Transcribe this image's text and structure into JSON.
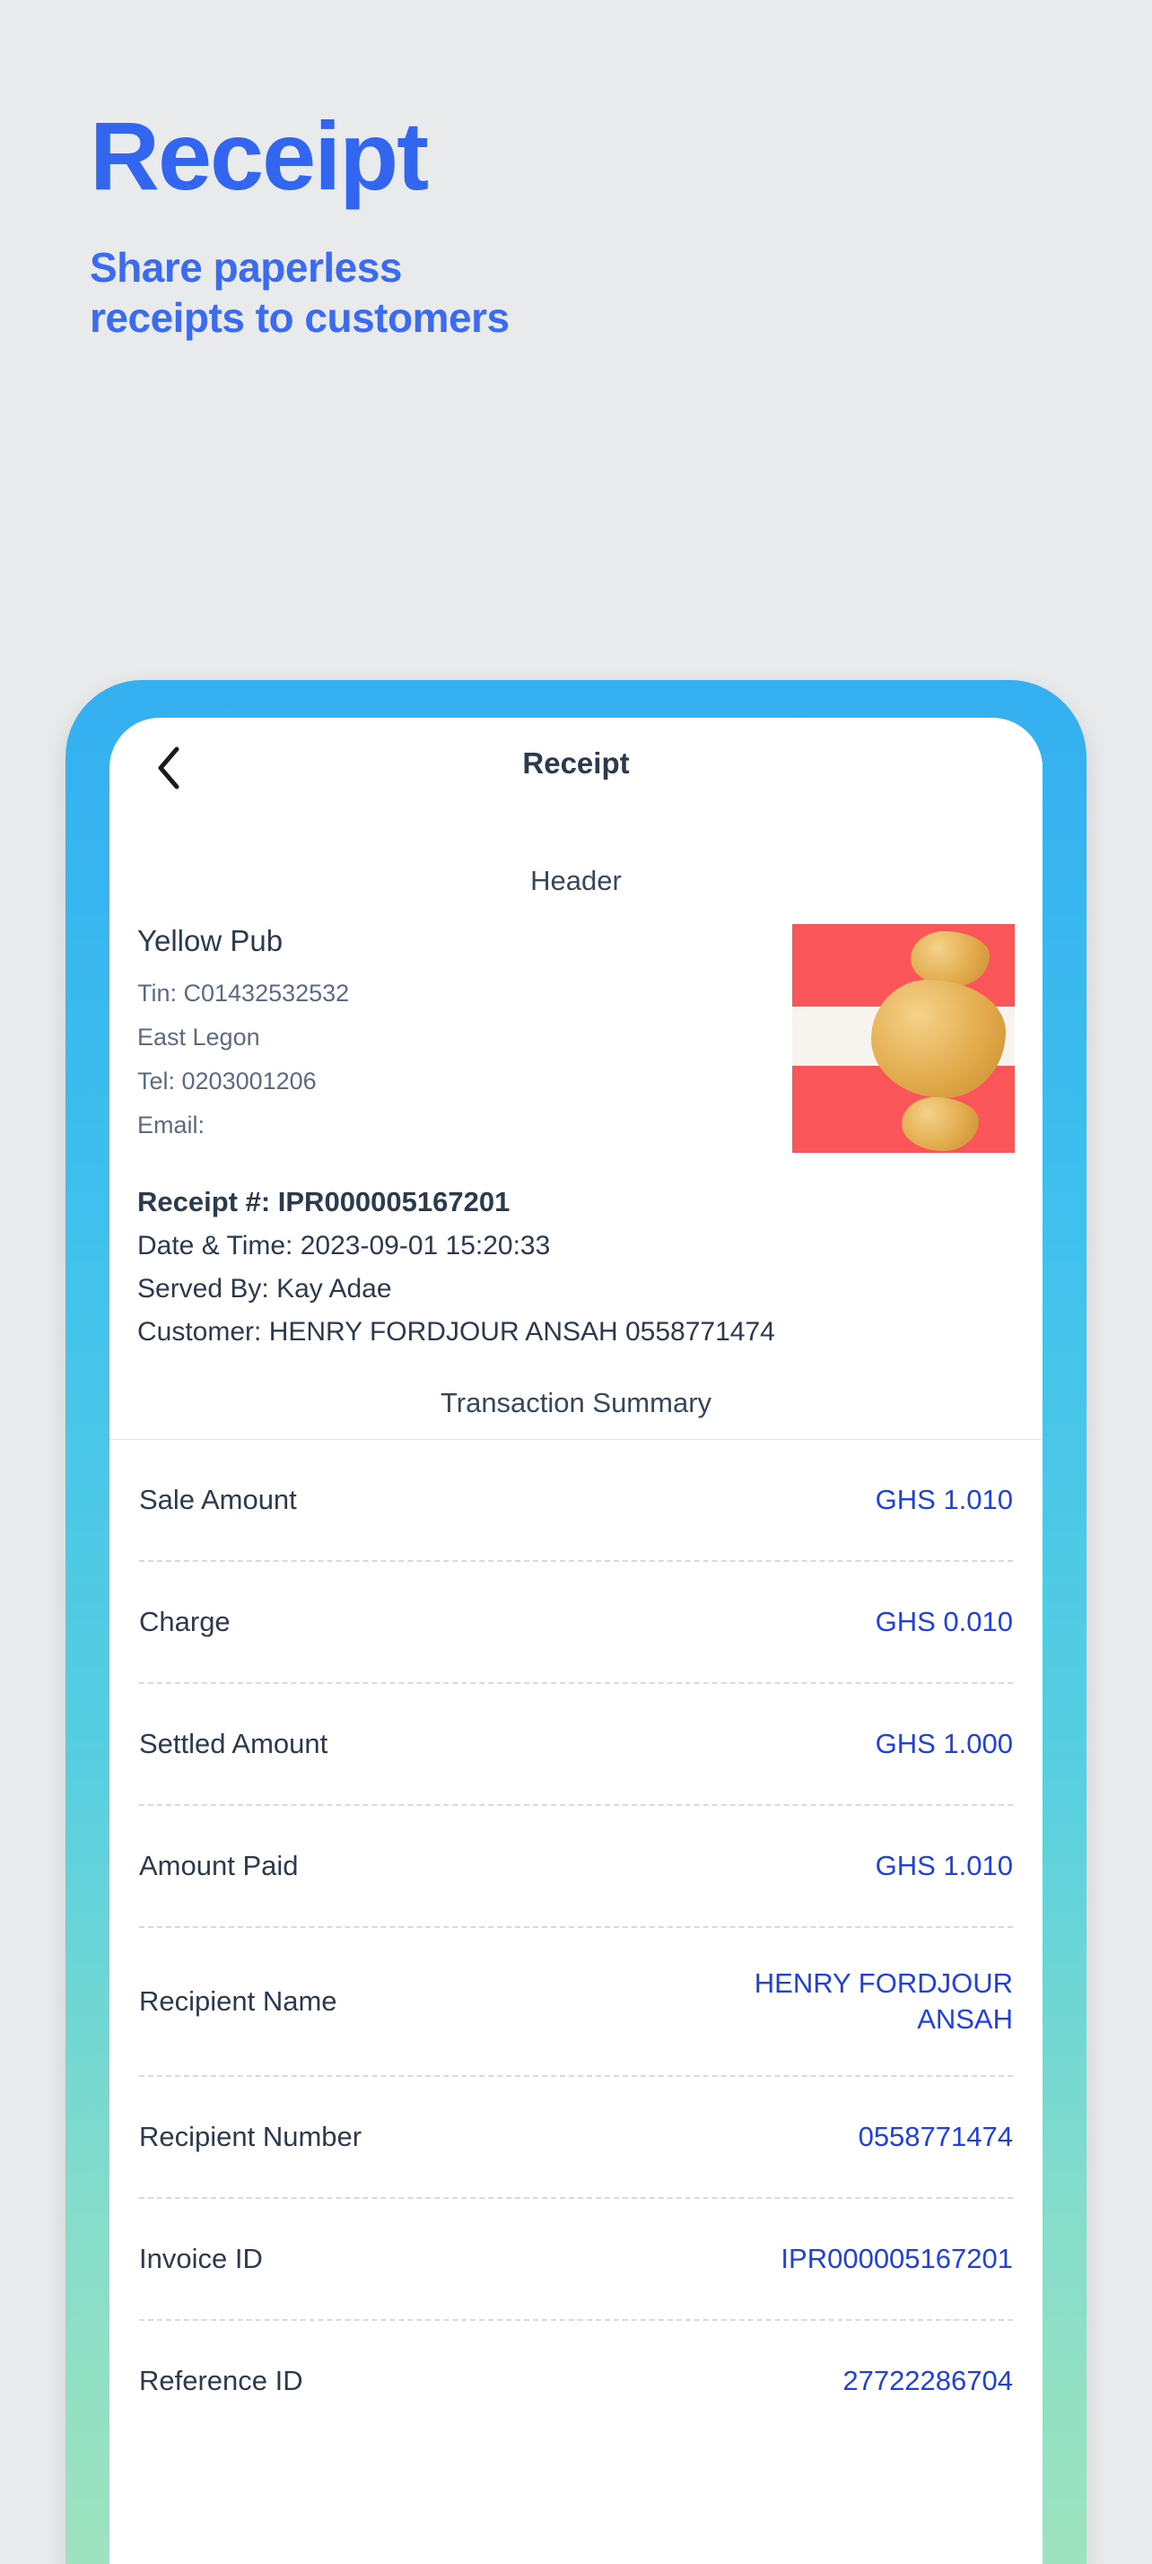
{
  "promo": {
    "title": "Receipt",
    "subtitle_line1": "Share paperless",
    "subtitle_line2": "receipts to customers",
    "title_color": "#3366f0"
  },
  "phone": {
    "frame_gradient_start": "#34aff0",
    "frame_gradient_end": "#9ee3bf"
  },
  "appbar": {
    "back_icon": "chevron-left-icon",
    "title": "Receipt"
  },
  "receipt": {
    "header_label": "Header",
    "merchant": {
      "name": "Yellow Pub",
      "tin": "Tin: C01432532532",
      "address": "East Legon",
      "tel": "Tel: 0203001206",
      "email": "Email:"
    },
    "logo": {
      "name": "merchant-logo",
      "background_color": "#fa5558",
      "band_color": "#f7f3ef"
    },
    "meta": {
      "receipt_number": "Receipt #: IPR000005167201",
      "date_time": "Date & Time: 2023-09-01 15:20:33",
      "served_by": "Served By: Kay Adae",
      "customer": "Customer: HENRY FORDJOUR ANSAH 0558771474"
    },
    "summary_label": "Transaction Summary",
    "value_color": "#2040e0",
    "rows": [
      {
        "key": "Sale Amount",
        "value": "GHS 1.010"
      },
      {
        "key": "Charge",
        "value": "GHS 0.010"
      },
      {
        "key": "Settled Amount",
        "value": "GHS 1.000"
      },
      {
        "key": "Amount Paid",
        "value": "GHS 1.010"
      },
      {
        "key": "Recipient Name",
        "value": "HENRY FORDJOUR ANSAH"
      },
      {
        "key": "Recipient Number",
        "value": "0558771474"
      },
      {
        "key": "Invoice ID",
        "value": "IPR000005167201"
      },
      {
        "key": "Reference ID",
        "value": "27722286704"
      }
    ]
  }
}
